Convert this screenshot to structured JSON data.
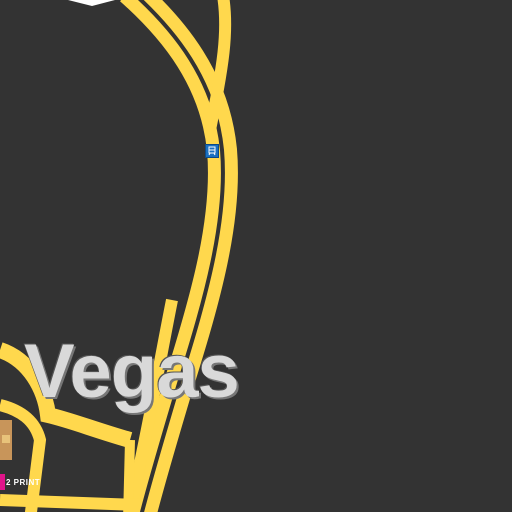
{
  "map": {
    "city_label": "Vegas",
    "poi_label": "2 PRINT",
    "colors": {
      "background": "#333333",
      "road": "#ffd84d",
      "road_edge": "#d9b02e",
      "label": "#d9d9d9",
      "transit": "#1a6fc0",
      "poi_badge": "#e0148a",
      "building": "#c8955a"
    },
    "icons": [
      "transit-station-icon",
      "poi-marker-icon"
    ]
  }
}
